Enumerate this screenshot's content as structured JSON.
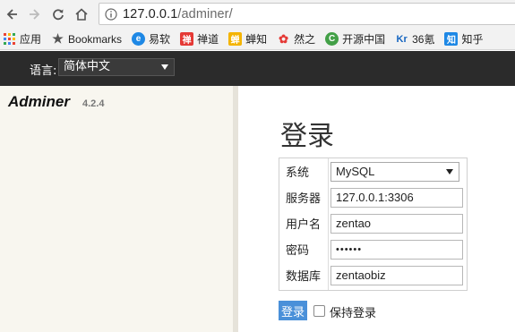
{
  "browser": {
    "url_host": "127.0.0.1",
    "url_path": "/adminer/",
    "bookmarks": [
      {
        "label": "应用",
        "icon": "apps-grid-icon",
        "color": "#4285f4"
      },
      {
        "label": "Bookmarks",
        "icon": "star-icon",
        "color": "#555555"
      },
      {
        "label": "易软",
        "icon": "ie-logo-icon",
        "color": "#1e88e5"
      },
      {
        "label": "禅道",
        "icon": "zentao-logo-icon",
        "color": "#e53935"
      },
      {
        "label": "蝉知",
        "icon": "chanzhi-logo-icon",
        "color": "#f4b400"
      },
      {
        "label": "然之",
        "icon": "ranzhi-logo-icon",
        "color": "#e53935"
      },
      {
        "label": "开源中国",
        "icon": "oschina-logo-icon",
        "color": "#43a047"
      },
      {
        "label": "36氪",
        "icon": "kr36-logo-icon",
        "color": "#1565c0"
      },
      {
        "label": "知乎",
        "icon": "zhihu-logo-icon",
        "color": "#1e88e5"
      }
    ]
  },
  "lang_bar": {
    "label": "语言:",
    "selected": "简体中文"
  },
  "sidebar": {
    "title": "Adminer",
    "version": "4.2.4"
  },
  "login": {
    "title": "登录",
    "fields": [
      {
        "label": "系统",
        "value": "MySQL"
      },
      {
        "label": "服务器",
        "value": "127.0.0.1:3306"
      },
      {
        "label": "用户名",
        "value": "zentao"
      },
      {
        "label": "密码",
        "value": "••••••"
      },
      {
        "label": "数据库",
        "value": "zentaobiz"
      }
    ],
    "submit_label": "登录",
    "permanent_label": "保持登录"
  },
  "colors": {
    "lang_bar_bg": "#2b2b2b",
    "sidebar_bg": "#f8f6ef",
    "button_bg": "#4a90d9"
  }
}
